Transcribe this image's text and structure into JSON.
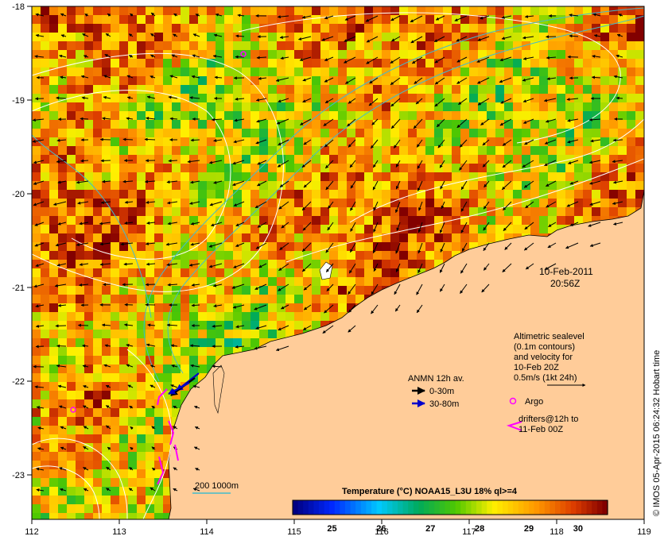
{
  "map": {
    "date_line": "10-Feb-2011",
    "time_line": "20:56Z",
    "credit": "© IMOS 05-Apr-2015 06:24:32 Hobart time",
    "lon_labels": [
      "112",
      "113",
      "114",
      "115",
      "116",
      "117",
      "118",
      "119"
    ],
    "lat_labels": [
      "-18",
      "-19",
      "-20",
      "-21",
      "-22",
      "-23"
    ],
    "colorbar": {
      "title": "Temperature (°C) NOAA15_L3U 18% ql>=4",
      "ticks": [
        "25",
        "26",
        "27",
        "28",
        "29",
        "30"
      ],
      "vmin": 24.2,
      "vmax": 30.6
    },
    "legend": {
      "alt_line1": "Altimetric sealevel",
      "alt_line2": "(0.1m contours)",
      "alt_line3": "and velocity for",
      "alt_line4": "10-Feb 20Z",
      "alt_line5": "0.5m/s (1kt 24h)",
      "anmn_title": "ANMN 12h av.",
      "anmn_shallow": "0-30m",
      "anmn_deep": "30-80m",
      "argo": "Argo",
      "drifters_line1": "drifters@12h to",
      "drifters_line2": "11-Feb 00Z",
      "isobaths": "200  1000m"
    },
    "colors": {
      "land": "#ffcc99",
      "argo": "#ff00ff",
      "drifters": "#ff00ff",
      "anmn_shallow": "#000000",
      "anmn_deep": "#0000cc",
      "isobath": "#44bbcc",
      "contour": "#ffffff"
    }
  }
}
